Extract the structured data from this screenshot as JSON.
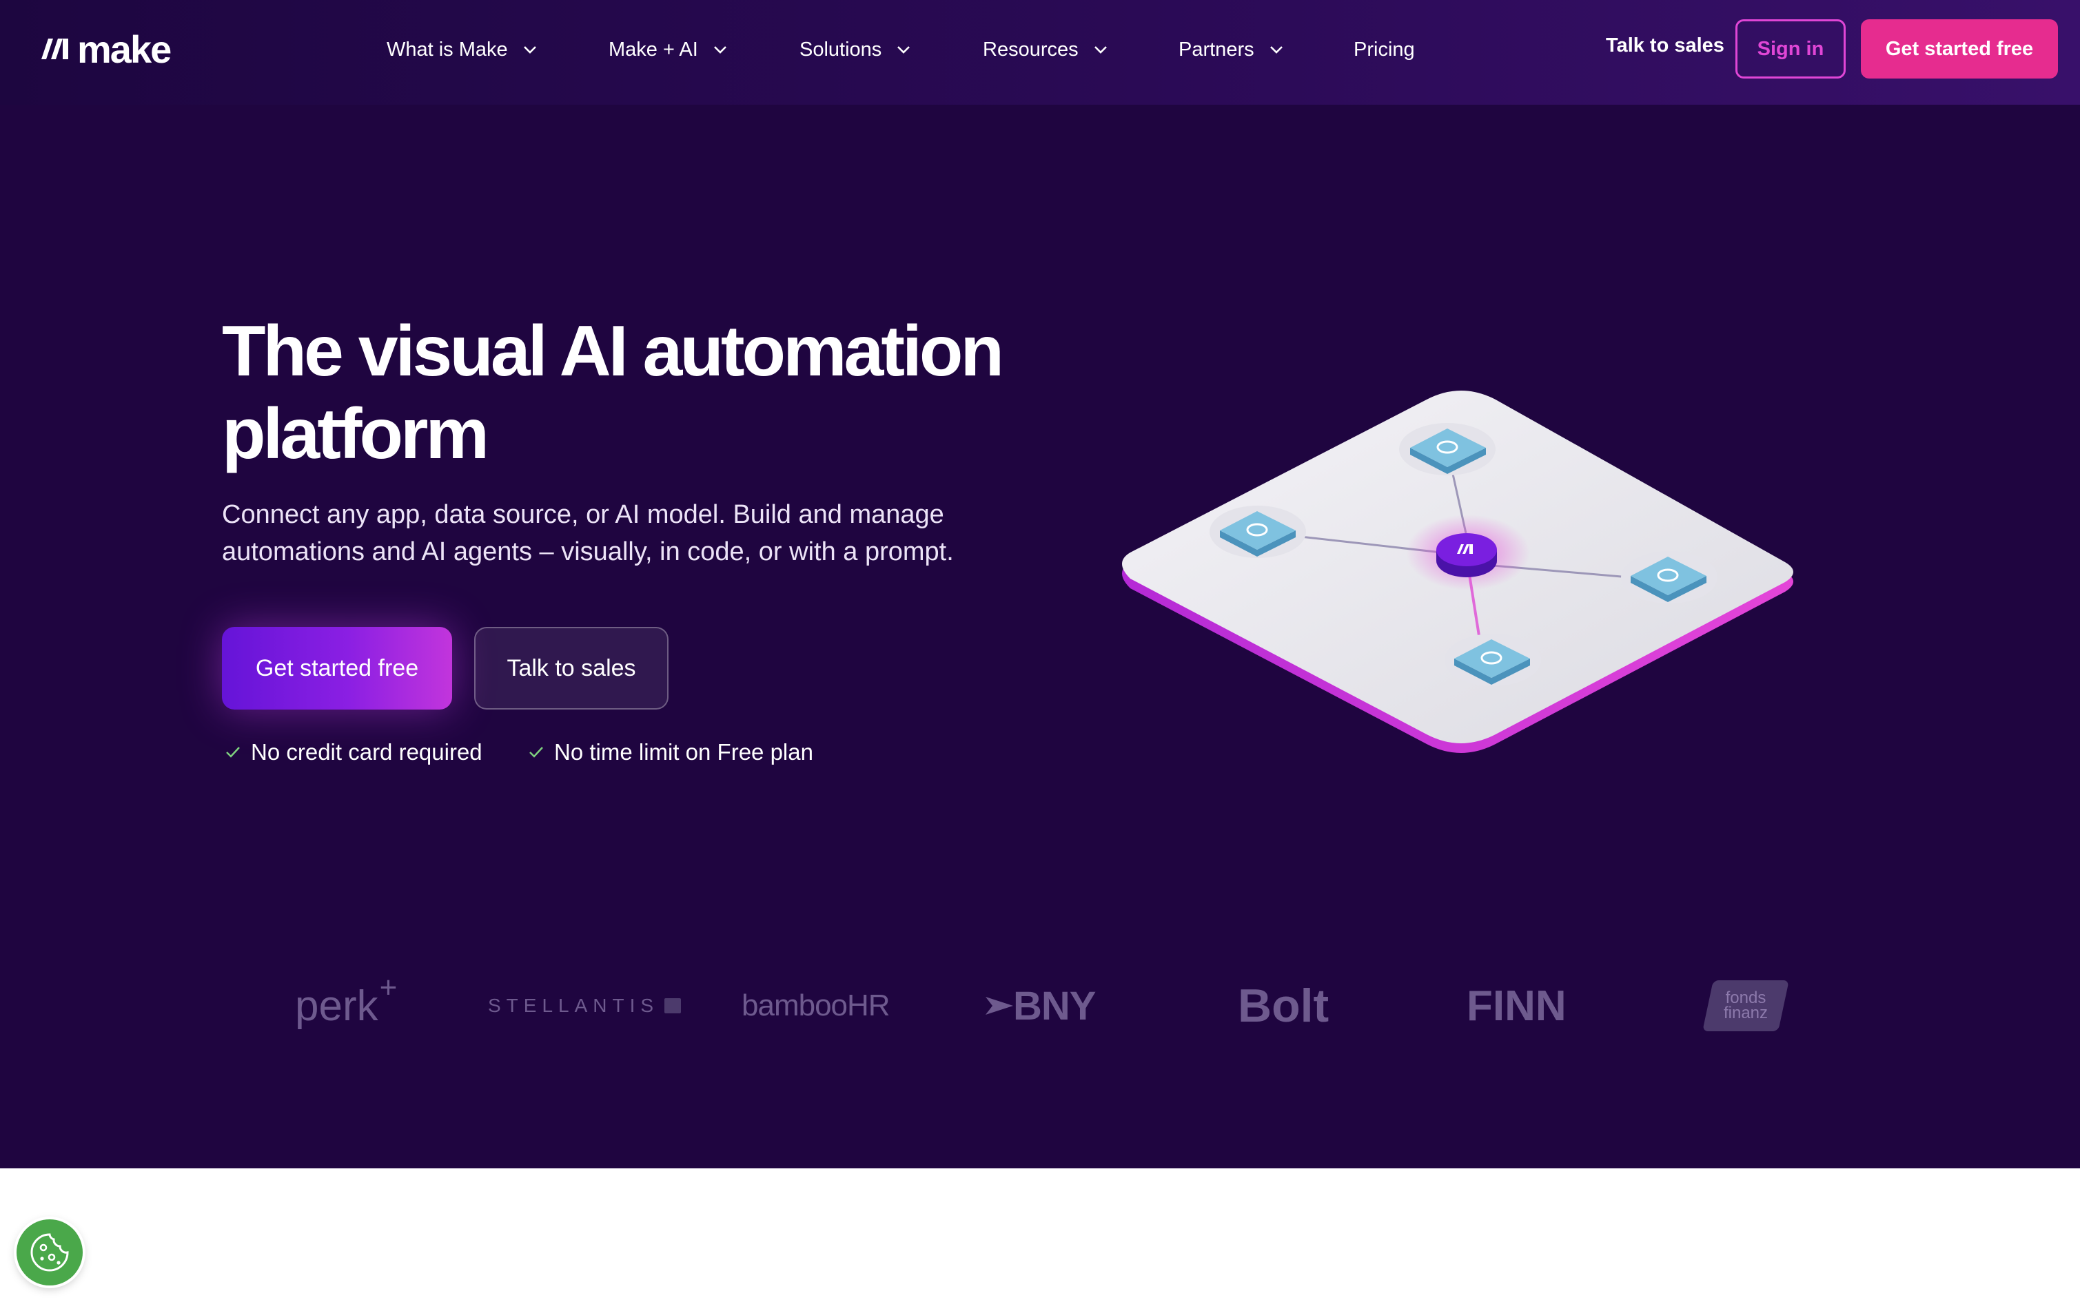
{
  "brand": {
    "name": "make",
    "icon": "make-logo-icon"
  },
  "nav": {
    "items": [
      {
        "label": "What is Make",
        "has_dropdown": true
      },
      {
        "label": "Make + AI",
        "has_dropdown": true
      },
      {
        "label": "Solutions",
        "has_dropdown": true
      },
      {
        "label": "Resources",
        "has_dropdown": true
      },
      {
        "label": "Partners",
        "has_dropdown": true
      },
      {
        "label": "Pricing",
        "has_dropdown": false
      }
    ],
    "talk_to_sales": "Talk to sales",
    "sign_in": "Sign in",
    "get_started": "Get started free"
  },
  "hero": {
    "headline_line1": "The visual AI automation",
    "headline_line2": "platform",
    "subtitle_line1": "Connect any app, data source, or AI model. Build and manage",
    "subtitle_line2": "automations and AI agents – visually, in code, or with a prompt.",
    "cta_primary": "Get started free",
    "cta_secondary": "Talk to sales",
    "checks": [
      "No credit card required",
      "No time limit on Free plan"
    ]
  },
  "customer_logos": [
    "perk",
    "STELLANTIS",
    "bambooHR",
    "BNY",
    "Bolt",
    "FINN",
    "fonds finanz"
  ],
  "colors": {
    "hero_bg": "#1f0540",
    "accent_pink": "#e62c8f",
    "accent_magenta": "#e046d6",
    "accent_purple": "#6514d8",
    "cookie_green": "#4aa84a"
  }
}
